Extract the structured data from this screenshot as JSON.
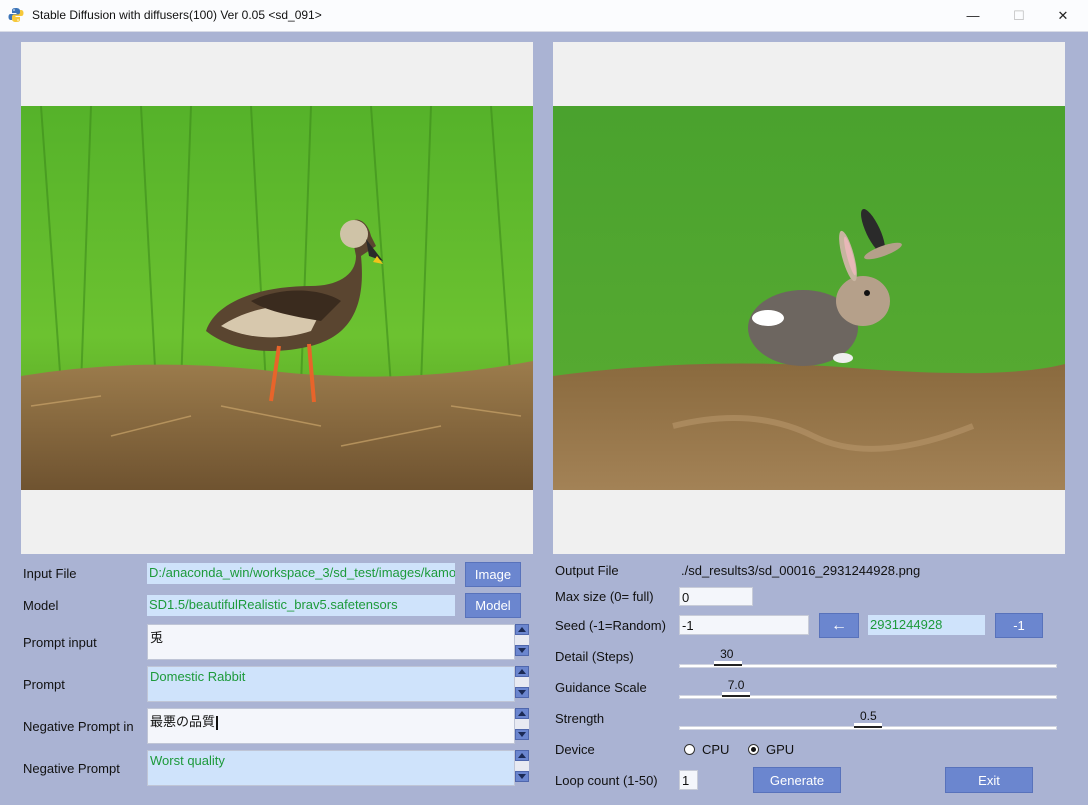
{
  "window": {
    "title": "Stable Diffusion with diffusers(100)  Ver 0.05 <sd_091>",
    "minimize": "—",
    "maximize": "☐",
    "close": "✕"
  },
  "left": {
    "input_file_label": "Input File",
    "input_file_value": "D:/anaconda_win/workspace_3/sd_test/images/kamo",
    "image_button": "Image",
    "model_label": "Model",
    "model_value": "SD1.5/beautifulRealistic_brav5.safetensors",
    "model_button": "Model",
    "prompt_input_label": "Prompt input",
    "prompt_input_value": "兎",
    "prompt_label": "Prompt",
    "prompt_value": "Domestic Rabbit",
    "neg_prompt_input_label": "Negative Prompt in",
    "neg_prompt_input_value": "最悪の品質",
    "neg_prompt_label": "Negative Prompt",
    "neg_prompt_value": "Worst quality"
  },
  "right": {
    "output_file_label": "Output File",
    "output_file_value": "./sd_results3/sd_00016_2931244928.png",
    "max_size_label": "Max size (0= full)",
    "max_size_value": "0",
    "seed_label": "Seed  (-1=Random)",
    "seed_value": "-1",
    "seed_arrow_button": "←",
    "seed_result": "2931244928",
    "seed_minus_button": "-1",
    "steps_label": "Detail (Steps)",
    "steps_value": "30",
    "guidance_label": "Guidance Scale",
    "guidance_value": "7.0",
    "strength_label": "Strength",
    "strength_value": "0.5",
    "device_label": "Device",
    "device_cpu": "CPU",
    "device_gpu": "GPU",
    "device_selected": "GPU",
    "loop_label": "Loop count (1-50)",
    "loop_value": "1",
    "generate_button": "Generate",
    "exit_button": "Exit"
  },
  "sliders": {
    "steps_fraction": 0.13,
    "guidance_fraction": 0.15,
    "strength_fraction": 0.5
  },
  "colors": {
    "background": "#aab3d3",
    "button": "#6b86cf",
    "field_blue": "#cfe3fb",
    "field_text_green": "#1d9a3b"
  },
  "icons": {
    "app": "python-logo-icon",
    "scroll_up": "scroll-up-arrow-icon",
    "scroll_down": "scroll-down-arrow-icon"
  }
}
